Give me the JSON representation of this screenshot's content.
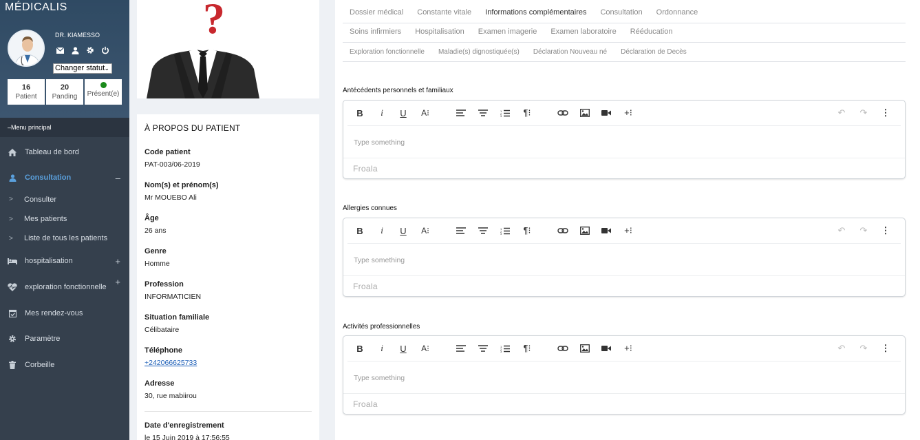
{
  "app": {
    "brand": "MÉDICALIS"
  },
  "profile": {
    "doctor_name": "DR. KIAMESSO",
    "status_select": "Changer statut",
    "stats": [
      {
        "value": "16",
        "label": "Patient"
      },
      {
        "value": "20",
        "label": "Panding"
      },
      {
        "value": "",
        "label": "Présent(e)",
        "dot_color": "#1a8a1a"
      }
    ]
  },
  "menu": {
    "header": "–Menu principal",
    "items": [
      {
        "label": "Tableau de bord",
        "icon": "home-icon"
      },
      {
        "label": "Consultation",
        "icon": "user-doctor-icon",
        "toggle": "–"
      },
      {
        "label": "hospitalisation",
        "icon": "bed-icon",
        "toggle": "+"
      },
      {
        "label": "exploration fonctionnelle",
        "icon": "heartbeat-icon",
        "toggle": "+"
      },
      {
        "label": "Mes rendez-vous",
        "icon": "calendar-check-icon"
      },
      {
        "label": "Paramètre",
        "icon": "gear-icon"
      },
      {
        "label": "Corbeille",
        "icon": "trash-icon"
      }
    ],
    "sub_items": [
      {
        "label": "Consulter"
      },
      {
        "label": "Mes patients"
      },
      {
        "label": "Liste de tous les patients"
      }
    ]
  },
  "patient": {
    "title": "À PROPOS DU PATIENT",
    "fields": [
      {
        "label": "Code patient",
        "value": "PAT-003/06-2019"
      },
      {
        "label": "Nom(s) et prénom(s)",
        "value": "Mr MOUEBO Ali"
      },
      {
        "label": "Âge",
        "value": "26 ans"
      },
      {
        "label": "Genre",
        "value": "Homme"
      },
      {
        "label": "Profession",
        "value": "INFORMATICIEN"
      },
      {
        "label": "Situation familiale",
        "value": "Célibataire"
      },
      {
        "label": "Téléphone",
        "value": "+242066625733"
      },
      {
        "label": "Adresse",
        "value": "30, rue mabiirou"
      },
      {
        "label": "Date d'enregistrement",
        "value": "le 15 Juin 2019 à 17:56:55"
      }
    ]
  },
  "tabs": {
    "row1": [
      "Dossier médical",
      "Constante vitale",
      "Informations complémentaires",
      "Consultation",
      "Ordonnance"
    ],
    "row2": [
      "Soins infirmiers",
      "Hospitalisation",
      "Examen imagerie",
      "Examen laboratoire",
      "Rééducation"
    ],
    "row3": [
      "Exploration fonctionnelle",
      "Maladie(s) dignostiquée(s)",
      "Déclaration Nouveau né",
      "Déclaration de Decès"
    ],
    "active": "Informations complémentaires"
  },
  "sections": [
    {
      "label": "Antécédents personnels et familiaux",
      "placeholder": "Type something",
      "footer": "Froala"
    },
    {
      "label": "Allergies connues",
      "placeholder": "Type something",
      "footer": "Froala"
    },
    {
      "label": "Activités professionnelles",
      "placeholder": "Type something",
      "footer": "Froala"
    }
  ],
  "toolbar": {
    "buttons": [
      "bold-icon",
      "italic-icon",
      "underline-icon",
      "font-size-icon",
      "align-left-icon",
      "align-center-icon",
      "ordered-list-icon",
      "paragraph-format-icon",
      "link-icon",
      "image-icon",
      "video-icon",
      "insert-more-icon",
      "undo-icon",
      "redo-icon",
      "more-vertical-icon"
    ]
  },
  "colors": {
    "sidebar": "#35404d",
    "accent": "#5aa0dd",
    "present": "#1a8a1a"
  }
}
